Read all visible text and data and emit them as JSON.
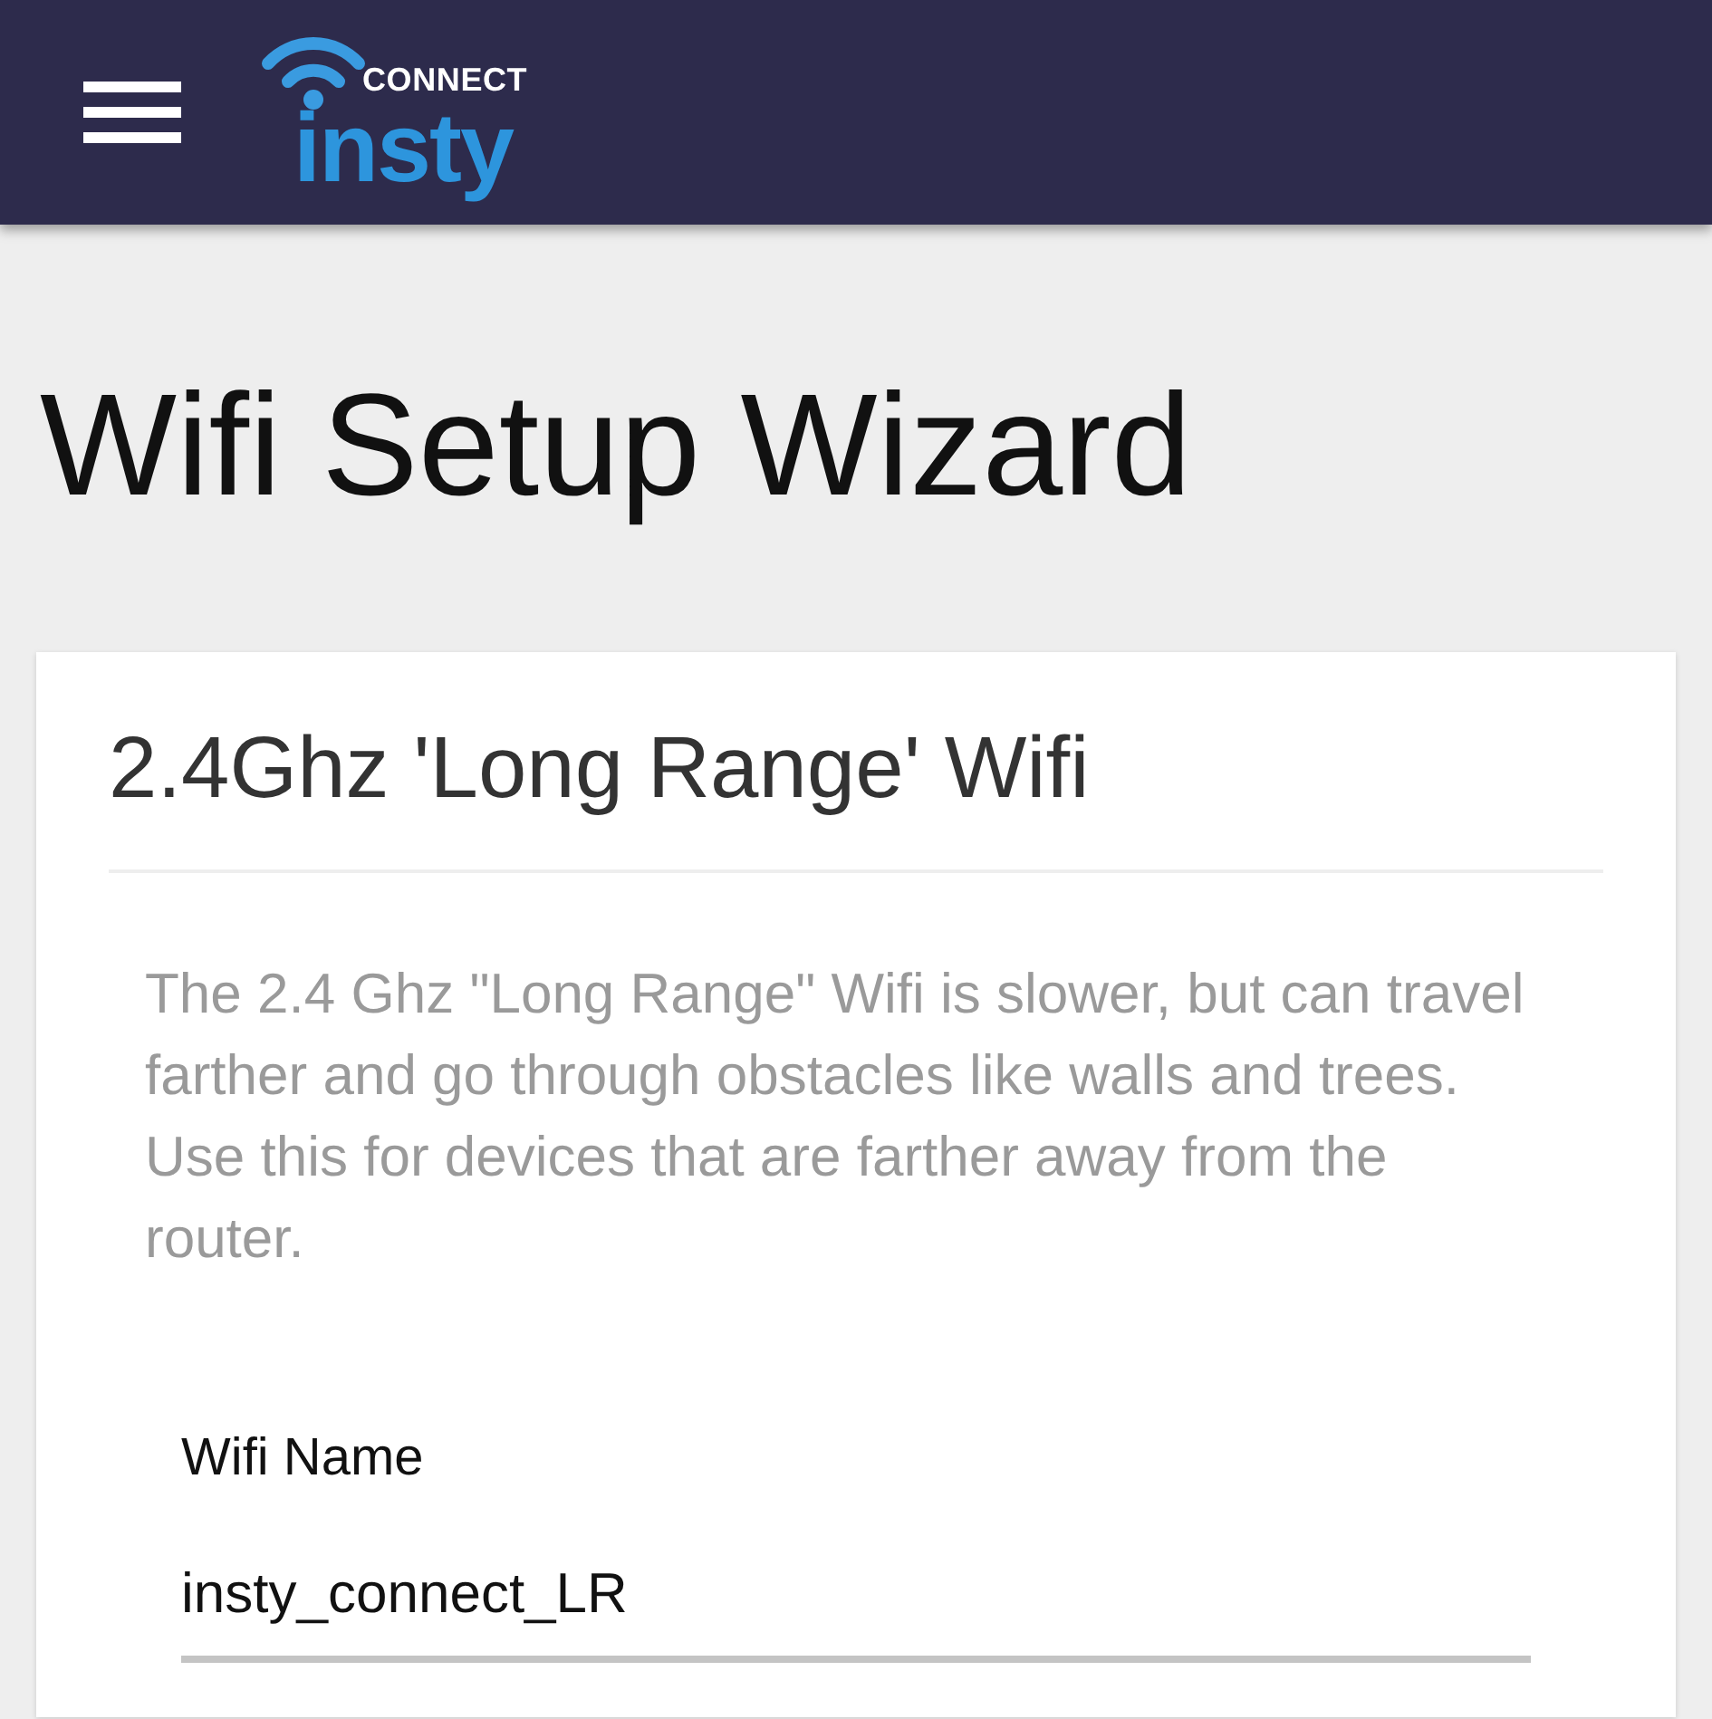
{
  "header": {
    "logo": {
      "tagline": "CONNECT",
      "wordmark": "insty"
    }
  },
  "page_title": "Wifi Setup Wizard",
  "card": {
    "title": "2.4Ghz 'Long Range' Wifi",
    "description": "The 2.4 Ghz \"Long Range\" Wifi is slower, but can travel farther and go through obstacles like walls and trees. Use this for devices that are farther away from the router.",
    "fields": [
      {
        "label": "Wifi Name",
        "value": "insty_connect_LR"
      }
    ]
  }
}
